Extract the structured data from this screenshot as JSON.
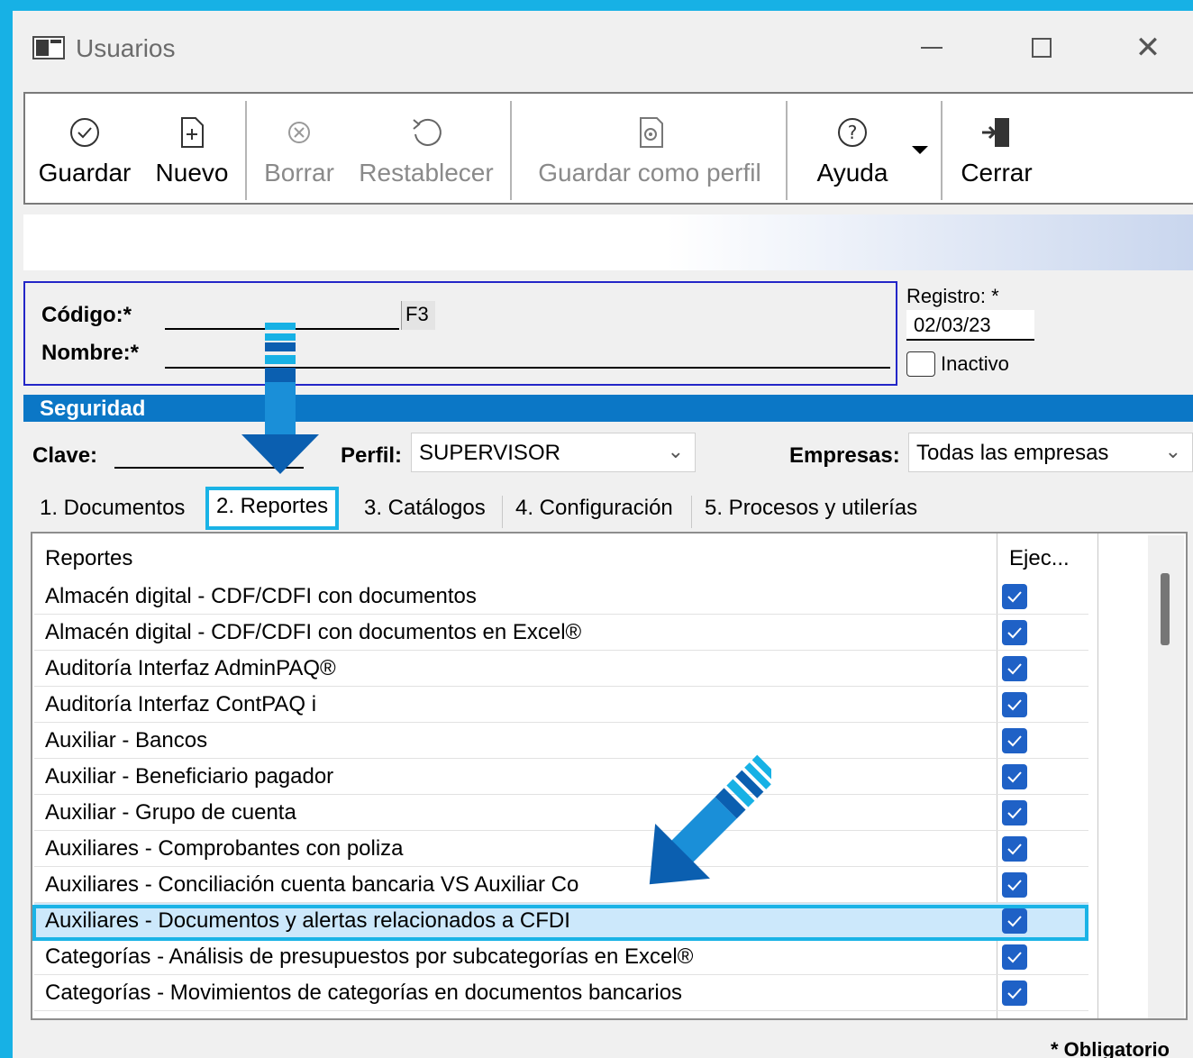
{
  "window": {
    "title": "Usuarios"
  },
  "toolbar": {
    "guardar": "Guardar",
    "nuevo": "Nuevo",
    "borrar": "Borrar",
    "restablecer": "Restablecer",
    "guardar_perfil": "Guardar como perfil",
    "ayuda": "Ayuda",
    "cerrar": "Cerrar"
  },
  "form": {
    "codigo_label": "Código:*",
    "codigo_value": "",
    "f3_button": "F3",
    "nombre_label": "Nombre:*",
    "nombre_value": "",
    "registro_label": "Registro: *",
    "registro_value": "02/03/23",
    "inactivo_label": "Inactivo"
  },
  "seguridad": {
    "title": "Seguridad",
    "clave_label": "Clave:",
    "clave_value": "",
    "perfil_label": "Perfil:",
    "perfil_value": "SUPERVISOR",
    "empresas_label": "Empresas:",
    "empresas_value": "Todas las empresas"
  },
  "tabs": [
    {
      "label": "1. Documentos",
      "active": false
    },
    {
      "label": "2. Reportes",
      "active": true
    },
    {
      "label": "3. Catálogos",
      "active": false
    },
    {
      "label": "4. Configuración",
      "active": false
    },
    {
      "label": "5. Procesos y utilerías",
      "active": false
    }
  ],
  "grid": {
    "col_reportes": "Reportes",
    "col_ejecutar": "Ejec...",
    "rows": [
      {
        "name": "Almacén digital - CDF/CDFI con documentos",
        "checked": true
      },
      {
        "name": "Almacén digital - CDF/CDFI con documentos en Excel®",
        "checked": true
      },
      {
        "name": "Auditoría Interfaz AdminPAQ®",
        "checked": true
      },
      {
        "name": "Auditoría Interfaz ContPAQ i",
        "checked": true
      },
      {
        "name": "Auxiliar - Bancos",
        "checked": true
      },
      {
        "name": "Auxiliar - Beneficiario pagador",
        "checked": true
      },
      {
        "name": "Auxiliar - Grupo de cuenta",
        "checked": true
      },
      {
        "name": "Auxiliares - Comprobantes con poliza",
        "checked": true
      },
      {
        "name": "Auxiliares - Conciliación cuenta bancaria VS Auxiliar Co",
        "checked": true
      },
      {
        "name": "Auxiliares - Documentos y alertas relacionados a CFDI",
        "checked": true,
        "selected": true
      },
      {
        "name": "Categorías - Análisis de presupuestos por subcategorías en Excel®",
        "checked": true
      },
      {
        "name": "Categorías - Movimientos de categorías en documentos bancarios",
        "checked": true
      }
    ]
  },
  "footer": {
    "obligatorio": "* Obligatorio"
  },
  "colors": {
    "accent": "#17b1e5",
    "section_bar": "#0b77c6",
    "checkbox": "#1f61c6",
    "selected_row": "#cce8fb"
  }
}
